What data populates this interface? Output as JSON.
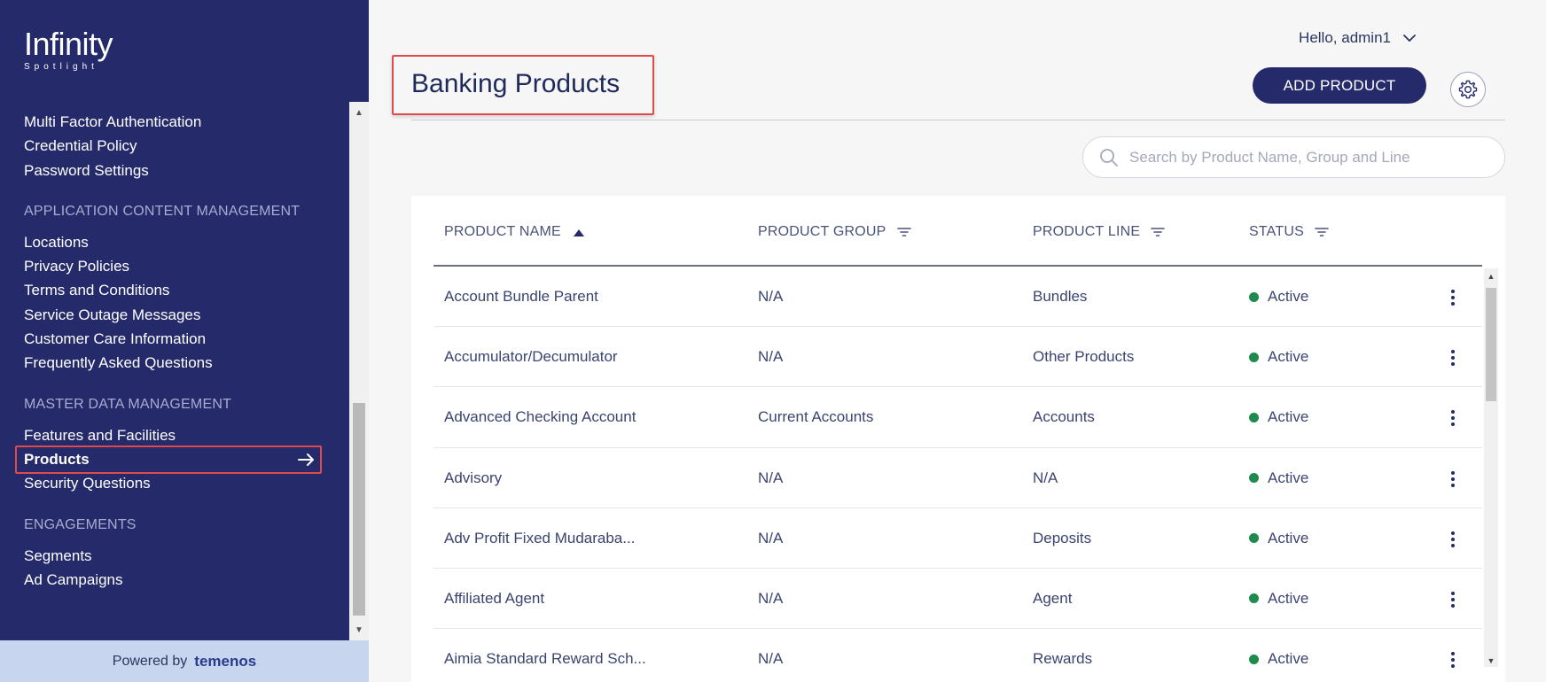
{
  "app": {
    "logo_name": "Infinity",
    "logo_sub": "Spotlight",
    "powered_by": "Powered by",
    "powered_brand": "temenos"
  },
  "sidebar": {
    "top_items": [
      "Multi Factor Authentication",
      "Credential Policy",
      "Password Settings"
    ],
    "sections": [
      {
        "heading": "APPLICATION CONTENT MANAGEMENT",
        "items": [
          "Locations",
          "Privacy Policies",
          "Terms and Conditions",
          "Service Outage Messages",
          "Customer Care Information",
          "Frequently Asked Questions"
        ]
      },
      {
        "heading": "MASTER DATA MANAGEMENT",
        "items": [
          "Features and Facilities",
          "Products",
          "Security Questions"
        ]
      },
      {
        "heading": "ENGAGEMENTS",
        "items": [
          "Segments",
          "Ad Campaigns"
        ]
      }
    ],
    "active_item": "Products"
  },
  "header": {
    "greeting": "Hello, admin1",
    "title": "Banking Products",
    "add_button": "ADD PRODUCT"
  },
  "search": {
    "placeholder": "Search by Product Name, Group and Line",
    "value": ""
  },
  "table": {
    "columns": [
      "PRODUCT NAME",
      "PRODUCT GROUP",
      "PRODUCT LINE",
      "STATUS"
    ],
    "sort_column": "PRODUCT NAME",
    "sort_direction": "ascending",
    "rows": [
      {
        "name": "Account Bundle Parent",
        "group": "N/A",
        "line": "Bundles",
        "status": "Active"
      },
      {
        "name": "Accumulator/Decumulator",
        "group": "N/A",
        "line": "Other Products",
        "status": "Active"
      },
      {
        "name": "Advanced Checking Account",
        "group": "Current Accounts",
        "line": "Accounts",
        "status": "Active"
      },
      {
        "name": "Advisory",
        "group": "N/A",
        "line": "N/A",
        "status": "Active"
      },
      {
        "name": "Adv Profit Fixed Mudaraba...",
        "group": "N/A",
        "line": "Deposits",
        "status": "Active"
      },
      {
        "name": "Affiliated Agent",
        "group": "N/A",
        "line": "Agent",
        "status": "Active"
      },
      {
        "name": "Aimia Standard Reward Sch...",
        "group": "N/A",
        "line": "Rewards",
        "status": "Active"
      }
    ]
  },
  "colors": {
    "sidebar_bg": "#252a6b",
    "accent": "#252a6b",
    "status_active": "#1f8a4c",
    "highlight_box": "#e04a4a",
    "powered_bg": "#c8d5ef"
  }
}
